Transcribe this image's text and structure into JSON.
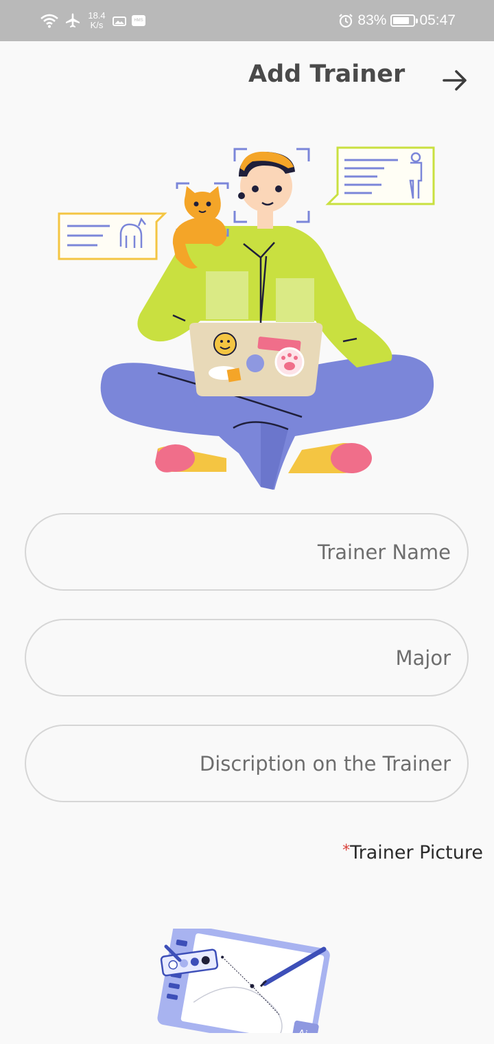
{
  "status_bar": {
    "network_speed_value": "18.4",
    "network_speed_unit": "K/s",
    "battery_percent": "83%",
    "battery_level": 0.83,
    "time": "05:47",
    "hms_badge": "HMS"
  },
  "app_bar": {
    "title": "Add Trainer",
    "icon": "arrow-right-icon"
  },
  "form": {
    "trainer_name_placeholder": "Trainer Name",
    "major_placeholder": "Major",
    "description_placeholder": "Discription on the Trainer",
    "picture_required_mark": "*",
    "picture_label": "Trainer Picture"
  },
  "colors": {
    "status_bar_bg": "#b9b9b9",
    "title_text": "#4a4a4a",
    "field_border": "#d6d6d6",
    "required_mark": "#d9413a",
    "accent_purple": "#7b86d9",
    "accent_lime": "#c9e040",
    "accent_orange": "#f4a528"
  }
}
